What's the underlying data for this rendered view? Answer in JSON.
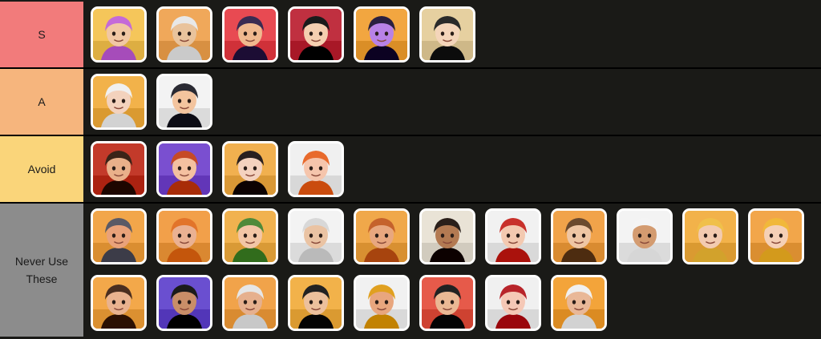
{
  "tiers": [
    {
      "label": "S",
      "color": "#f27b7b",
      "heroes": [
        {
          "name": "hero-purple-hair-masked",
          "bg": "#f5c65a",
          "skin": "#f1c7a4",
          "hair": "#c46ad8"
        },
        {
          "name": "hero-white-hair-swordsman",
          "bg": "#f0a85a",
          "skin": "#e9c39c",
          "hair": "#e8e8e8"
        },
        {
          "name": "hero-dark-hat-woman",
          "bg": "#e84a52",
          "skin": "#f0b98f",
          "hair": "#3a2b52"
        },
        {
          "name": "hero-black-hair-woman",
          "bg": "#c03040",
          "skin": "#f5cfb0",
          "hair": "#1b1b1b"
        },
        {
          "name": "hero-purple-skin-witch",
          "bg": "#f2a640",
          "skin": "#b882e6",
          "hair": "#2a2040"
        },
        {
          "name": "hero-pirate-hat-blonde",
          "bg": "#e6d0a0",
          "skin": "#f4d5ba",
          "hair": "#2a2a2a"
        }
      ]
    },
    {
      "label": "A",
      "color": "#f6b57d",
      "heroes": [
        {
          "name": "hero-white-hood-nun",
          "bg": "#f2b24a",
          "skin": "#f3d2bd",
          "hair": "#f0f0f0"
        },
        {
          "name": "hero-goggles-kid",
          "bg": "#f3f3f3",
          "skin": "#f3c49e",
          "hair": "#2a2a33"
        }
      ]
    },
    {
      "label": "Avoid",
      "color": "#fad57a",
      "heroes": [
        {
          "name": "hero-pirate-captain-beard",
          "bg": "#c33a2a",
          "skin": "#e9b08a",
          "hair": "#3b2418"
        },
        {
          "name": "hero-red-hair-mage",
          "bg": "#7a4fd0",
          "skin": "#f4c0a0",
          "hair": "#c64a26"
        },
        {
          "name": "hero-bangs-woman",
          "bg": "#f1b04f",
          "skin": "#f4d2bf",
          "hair": "#2a2020"
        },
        {
          "name": "hero-orange-hair-elf",
          "bg": "#f0f0f0",
          "skin": "#f5c5ac",
          "hair": "#e86a2c"
        }
      ]
    },
    {
      "label": "Never Use\nThese",
      "color": "#8c8c8c",
      "heroes": [
        {
          "name": "hero-helmet-brute",
          "bg": "#f2a64a",
          "skin": "#e9a27a",
          "hair": "#5a5a66"
        },
        {
          "name": "hero-orange-beard-dwarf",
          "bg": "#f2a04a",
          "skin": "#eab192",
          "hair": "#e2742a"
        },
        {
          "name": "hero-green-hood-archer",
          "bg": "#f1b24f",
          "skin": "#f3c6a6",
          "hair": "#4f8a3a"
        },
        {
          "name": "hero-goggles-old-man",
          "bg": "#f3f3f3",
          "skin": "#eac3a3",
          "hair": "#d8d8d8"
        },
        {
          "name": "hero-cowboy-hat-beard",
          "bg": "#f0a84a",
          "skin": "#e8a77f",
          "hair": "#c5622c"
        },
        {
          "name": "hero-dark-beard-warrior",
          "bg": "#e9e3d6",
          "skin": "#b37a52",
          "hair": "#2a1f1a"
        },
        {
          "name": "hero-red-hair-rogue",
          "bg": "#f1f1f1",
          "skin": "#f3c9b0",
          "hair": "#c8302a"
        },
        {
          "name": "hero-brown-hair-man",
          "bg": "#f1a34a",
          "skin": "#efc6a4",
          "hair": "#6b4a2e"
        },
        {
          "name": "hero-headscarf-sheikh",
          "bg": "#f3f3f3",
          "skin": "#d39b70",
          "hair": "#f4f4f4"
        },
        {
          "name": "hero-blonde-headband",
          "bg": "#f2b24a",
          "skin": "#f3cbb0",
          "hair": "#f0c04a"
        },
        {
          "name": "hero-blonde-knight",
          "bg": "#f2a64a",
          "skin": "#f5d0b6",
          "hair": "#f1b83a"
        },
        {
          "name": "hero-cap-kid",
          "bg": "#f3a84a",
          "skin": "#e9b28f",
          "hair": "#4a2e20"
        },
        {
          "name": "hero-black-hair-queen",
          "bg": "#6a4fd0",
          "skin": "#c98e68",
          "hair": "#1b1b1b"
        },
        {
          "name": "hero-white-beard-elder",
          "bg": "#f1a34a",
          "skin": "#e6b08e",
          "hair": "#e6e6e6"
        },
        {
          "name": "hero-spiky-hair-youth",
          "bg": "#f2b24a",
          "skin": "#ecc09c",
          "hair": "#222222"
        },
        {
          "name": "hero-spartan-helmet",
          "bg": "#f1f1f1",
          "skin": "#e8a67e",
          "hair": "#e0a020"
        },
        {
          "name": "hero-black-hair-fighter",
          "bg": "#e65a4a",
          "skin": "#eab894",
          "hair": "#222222"
        },
        {
          "name": "hero-red-hat-woman",
          "bg": "#f0f0f0",
          "skin": "#f5c8b6",
          "hair": "#b8242a"
        },
        {
          "name": "hero-white-beard-sage",
          "bg": "#f3a43a",
          "skin": "#e9b898",
          "hair": "#f0f0f0"
        }
      ]
    }
  ]
}
